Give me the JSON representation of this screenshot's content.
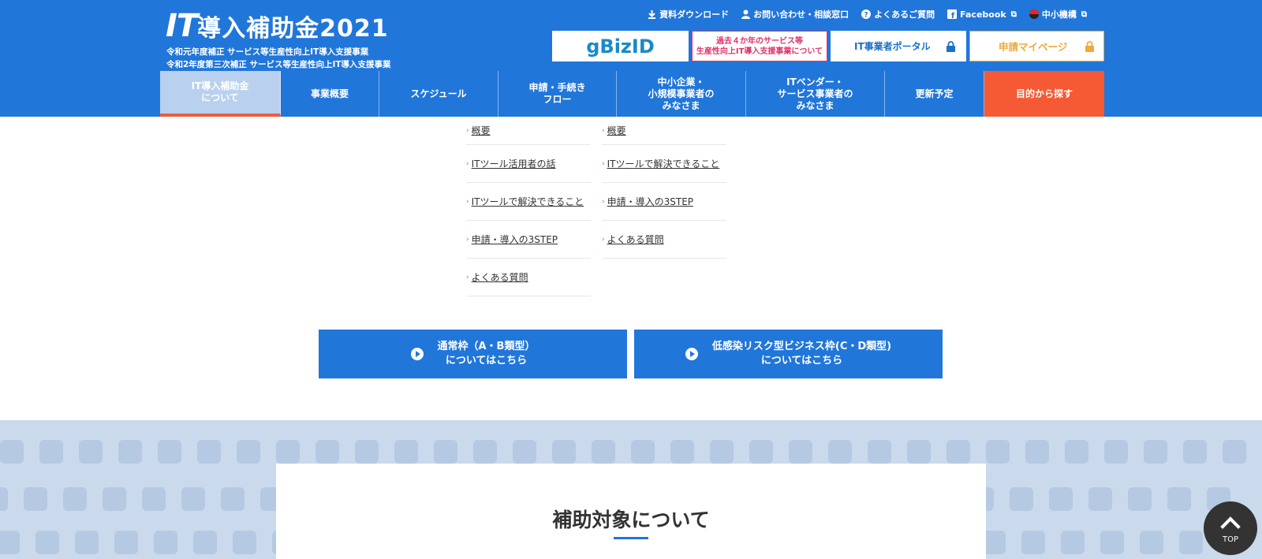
{
  "header": {
    "logo_it": "IT",
    "logo_rest": "導入補助金2021",
    "subtitle_1": "令和元年度補正 サービス等生産性向上IT導入支援事業",
    "subtitle_2": "令和2年度第三次補正 サービス等生産性向上IT導入支援事業",
    "brand_color": "#2176d9"
  },
  "util_links": {
    "download": "資料ダウンロード",
    "contact": "お問い合わせ・相談窓口",
    "faq": "よくあるご質問",
    "facebook": "Facebook",
    "smrj": "中小機構"
  },
  "banners": {
    "gbizid": "gBizID",
    "past_line1": "過去４か年のサービス等",
    "past_line2": "生産性向上IT導入支援事業について",
    "portal": "IT事業者ポータル",
    "mypage": "申請マイページ"
  },
  "nav": {
    "items": [
      "IT導入補助金\nについて",
      "事業概要",
      "スケジュール",
      "申請・手続き\nフロー",
      "中小企業・\n小規模事業者の\nみなさま",
      "ITベンダー・\nサービス事業者の\nみなさま",
      "更新予定",
      "目的から探す"
    ]
  },
  "submenu": {
    "left": [
      "概要",
      "ITツール活用者の話",
      "ITツールで解決できること",
      "申請・導入の3STEP",
      "よくある質問"
    ],
    "right": [
      "概要",
      "ITツールで解決できること",
      "申請・導入の3STEP",
      "よくある質問"
    ]
  },
  "cta": {
    "normal_line1": "通常枠（A・B類型）",
    "normal_line2": "についてはこちら",
    "lowrisk_line1": "低感染リスク型ビジネス枠(C・D類型)",
    "lowrisk_line2": "についてはこちら"
  },
  "section": {
    "title": "補助対象について"
  },
  "top_button": {
    "label": "TOP"
  }
}
